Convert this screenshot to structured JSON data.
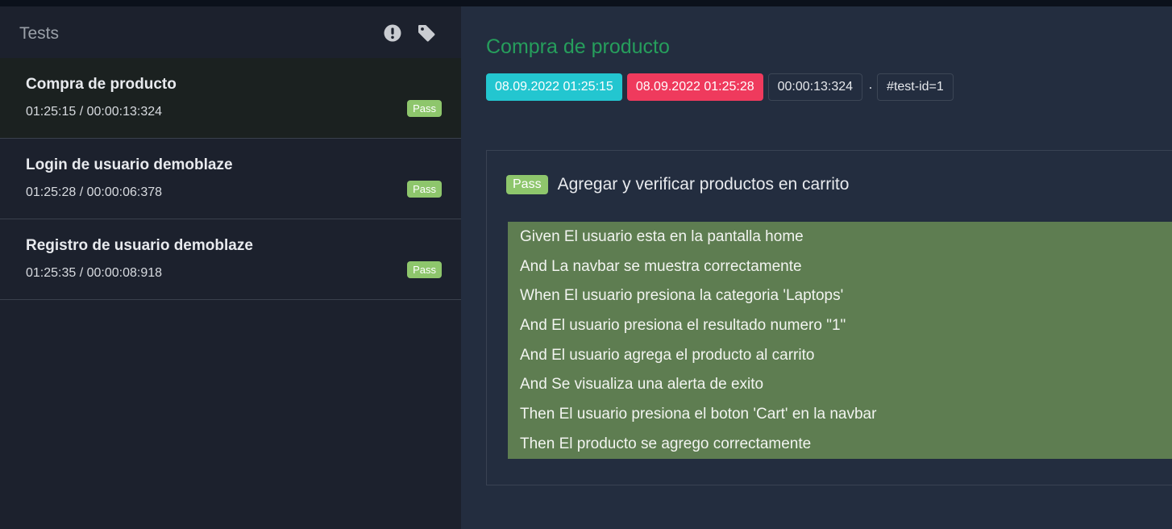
{
  "sidebar": {
    "title": "Tests",
    "header_icons": [
      "exclamation-circle-icon",
      "tag-icon"
    ],
    "tests": [
      {
        "name": "Compra de producto",
        "time": "01:25:15 / 00:00:13:324",
        "status": "Pass",
        "active": true
      },
      {
        "name": "Login de usuario demoblaze",
        "time": "01:25:28 / 00:00:06:378",
        "status": "Pass",
        "active": false
      },
      {
        "name": "Registro de usuario demoblaze",
        "time": "01:25:35 / 00:00:08:918",
        "status": "Pass",
        "active": false
      }
    ]
  },
  "detail": {
    "title": "Compra de producto",
    "start_time": "08.09.2022 01:25:15",
    "end_time": "08.09.2022 01:25:28",
    "duration": "00:00:13:324",
    "separator": "·",
    "test_id": "#test-id=1",
    "scenario": {
      "status": "Pass",
      "title": "Agregar y verificar productos en carrito",
      "steps": [
        "Given El usuario esta en la pantalla home",
        "And La navbar se muestra correctamente",
        "When El usuario presiona la categoria 'Laptops'",
        "And El usuario presiona el resultado numero \"1\"",
        "And El usuario agrega el producto al carrito",
        "And Se visualiza una alerta de exito",
        "Then El usuario presiona el boton 'Cart' en la navbar",
        "Then El producto se agrego correctamente"
      ]
    }
  },
  "colors": {
    "pass": "#8ec66c",
    "start_chip": "#23c6d0",
    "end_chip": "#ef3a5d",
    "title_green": "#269e5c",
    "steps_bg": "#5e7d51"
  }
}
